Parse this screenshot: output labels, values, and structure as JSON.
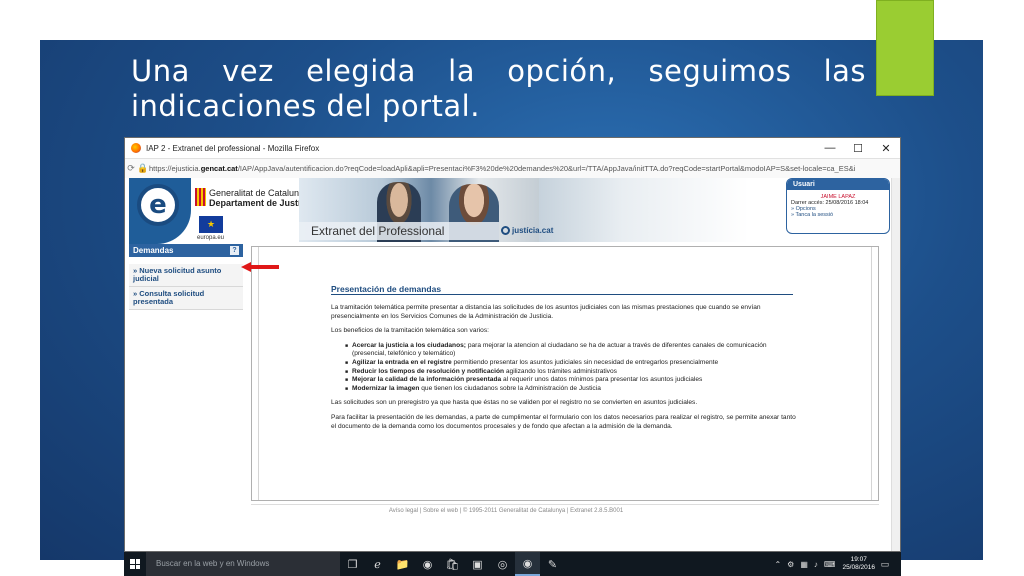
{
  "slide": {
    "title_line1": [
      "Una",
      "vez",
      "elegida",
      "la",
      "opción,",
      "seguimos",
      "las"
    ],
    "title_line2": "indicaciones del portal.",
    "accent_color": "#9acd32",
    "background_color": "#1d4f8a"
  },
  "browser": {
    "window_title": "IAP 2 - Extranet del professional - Mozilla Firefox",
    "url_prefix": "https://ejusticia.",
    "url_domain": "gencat.cat",
    "url_rest": "/IAP/AppJava/autentificacion.do?reqCode=loadApli&apli=Presentaci%F3%20de%20demandes%20&url=/TTA/AppJava/initTTA.do?reqCode=startPortal&modoIAP=S&set-locale=ca_ES&i",
    "controls": {
      "minimize": "—",
      "maximize": "☐",
      "close": "✕"
    }
  },
  "header": {
    "gencat_line1": "Generalitat de Catalunya",
    "gencat_line2": "Departament de Justícia",
    "eu_label": "europa.eu",
    "extranet_label": "Extranet del Professional",
    "justicia_label": "justícia.cat"
  },
  "user_box": {
    "title": "Usuari",
    "name": "JAIME LAPAZ",
    "last_access": "Darrer accés: 25/08/2016 18:04",
    "options_link": "» Opcions",
    "logout_link": "» Tanca la sessió"
  },
  "sidebar": {
    "title": "Demandas",
    "help": "?",
    "items": [
      {
        "label": "» Nueva solicitud asunto judicial"
      },
      {
        "label": "» Consulta solicitud presentada"
      }
    ]
  },
  "main": {
    "title": "Presentación de demandas",
    "intro": "La tramitación telemática permite presentar a distancia las solicitudes de los asuntos judiciales con las mismas prestaciones que cuando se envían presencialmente en los Servicios Comunes de la Administración de Justicia.",
    "benefits_intro": "Los beneficios de la tramitación telemática son varios:",
    "benefits": [
      {
        "bold": "Acercar la justicia a los ciudadanos;",
        "text": " para mejorar la atencion al ciudadano se ha de actuar a través de diferentes canales de comunicación (presencial, telefónico y telemático)"
      },
      {
        "bold": "Agilizar la entrada en el registre",
        "text": " permitiendo presentar los asuntos judiciales sin necesidad de entregarlos presencialmente"
      },
      {
        "bold": "Reducir los tiempos de resolución y notificación",
        "text": " agilizando los trámites administrativos"
      },
      {
        "bold": "Mejorar la calidad de la información presentada",
        "text": " al requerir unos datos mínimos para presentar los asuntos judiciales"
      },
      {
        "bold": "Modernizar la imagen",
        "text": " que tienen los ciudadanos sobre la Administración de Justicia"
      }
    ],
    "preregistro": "Las solicitudes son un preregistro ya que hasta que éstas no se validen por el registro no se convierten en asuntos judiciales.",
    "facilitar": "Para facilitar la presentación de les demandas, a parte de cumplimentar el formulario con los datos necesarios para realizar el registro, se permite anexar tanto el documento de la demanda como los documentos procesales y de fondo que afectan a la admisión de la demanda."
  },
  "footer": {
    "text": "Avíso legal  |  Sobre el web  |  © 1995-2011 Generalitat de Catalunya  |  Extranet 2.8.5.B001"
  },
  "taskbar": {
    "search_placeholder": "Buscar en la web y en Windows",
    "time": "19:07",
    "date": "25/08/2016"
  }
}
